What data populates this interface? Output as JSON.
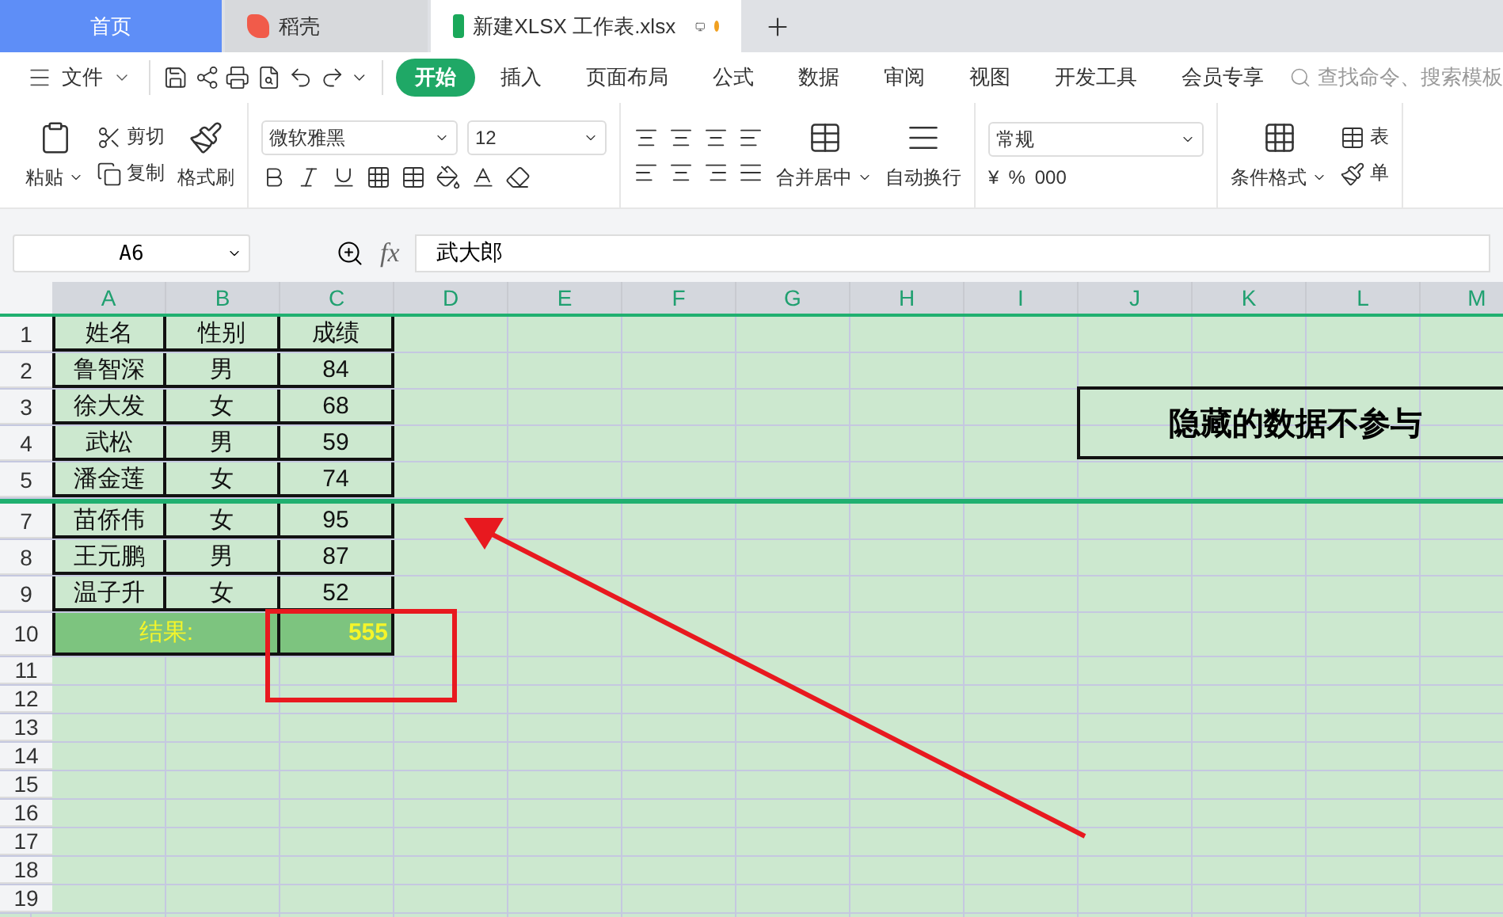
{
  "tabs": [
    {
      "kind": "home",
      "label": "首页",
      "selected": false,
      "unsaved": false
    },
    {
      "kind": "docer",
      "label": "稻壳",
      "selected": false,
      "unsaved": false
    },
    {
      "kind": "sheet",
      "label": "新建XLSX 工作表.xlsx",
      "selected": true,
      "unsaved": true
    }
  ],
  "menu": {
    "file": "文件",
    "ribbon_tabs": [
      {
        "label": "开始",
        "selected": true
      },
      {
        "label": "插入",
        "selected": false
      },
      {
        "label": "页面布局",
        "selected": false
      },
      {
        "label": "公式",
        "selected": false
      },
      {
        "label": "数据",
        "selected": false
      },
      {
        "label": "审阅",
        "selected": false
      },
      {
        "label": "视图",
        "selected": false
      },
      {
        "label": "开发工具",
        "selected": false
      },
      {
        "label": "会员专享",
        "selected": false
      }
    ],
    "search": {
      "placeholder": "查找命令、搜索模板"
    }
  },
  "toolbar": {
    "paste": "粘贴",
    "cut": "剪切",
    "copy": "复制",
    "format_painter": "格式刷",
    "font": "微软雅黑",
    "font_size": "12",
    "merge": "合并居中",
    "wrap": "自动换行",
    "number_format": "常规",
    "currency": "¥",
    "percent": "%",
    "thousands": "000",
    "conditional": "条件格式",
    "table_style": "表",
    "cell_style": "单"
  },
  "formula_bar": {
    "cell": "A6",
    "fx": "fx",
    "value": "武大郎"
  },
  "sheet": {
    "columns": [
      "A",
      "B",
      "C",
      "D",
      "E",
      "F",
      "G",
      "H",
      "I",
      "J",
      "K",
      "L",
      "M"
    ],
    "rows": [
      {
        "number": "1",
        "kind": "data",
        "hidden_before": false,
        "cells": [
          "姓名",
          "性别",
          "成绩"
        ]
      },
      {
        "number": "2",
        "kind": "data",
        "hidden_before": false,
        "cells": [
          "鲁智深",
          "男",
          "84"
        ]
      },
      {
        "number": "3",
        "kind": "data",
        "hidden_before": false,
        "cells": [
          "徐大发",
          "女",
          "68"
        ]
      },
      {
        "number": "4",
        "kind": "data",
        "hidden_before": false,
        "cells": [
          "武松",
          "男",
          "59"
        ]
      },
      {
        "number": "5",
        "kind": "data",
        "hidden_before": false,
        "cells": [
          "潘金莲",
          "女",
          "74"
        ]
      },
      {
        "number": "7",
        "kind": "data",
        "hidden_before": true,
        "cells": [
          "苗侨伟",
          "女",
          "95"
        ]
      },
      {
        "number": "8",
        "kind": "data",
        "hidden_before": false,
        "cells": [
          "王元鹏",
          "男",
          "87"
        ]
      },
      {
        "number": "9",
        "kind": "data",
        "hidden_before": false,
        "cells": [
          "温子升",
          "女",
          "52"
        ]
      },
      {
        "number": "10",
        "kind": "total",
        "hidden_before": false,
        "cells": [
          "结果:",
          "555"
        ]
      },
      {
        "number": "11",
        "kind": "empty",
        "hidden_before": false
      },
      {
        "number": "12",
        "kind": "empty",
        "hidden_before": false
      },
      {
        "number": "13",
        "kind": "empty",
        "hidden_before": false
      },
      {
        "number": "14",
        "kind": "empty",
        "hidden_before": false
      },
      {
        "number": "15",
        "kind": "empty",
        "hidden_before": false
      },
      {
        "number": "16",
        "kind": "empty",
        "hidden_before": false
      },
      {
        "number": "17",
        "kind": "empty",
        "hidden_before": false
      },
      {
        "number": "18",
        "kind": "empty",
        "hidden_before": false
      },
      {
        "number": "19",
        "kind": "empty",
        "hidden_before": false
      }
    ],
    "note": "隐藏的数据不参与"
  }
}
